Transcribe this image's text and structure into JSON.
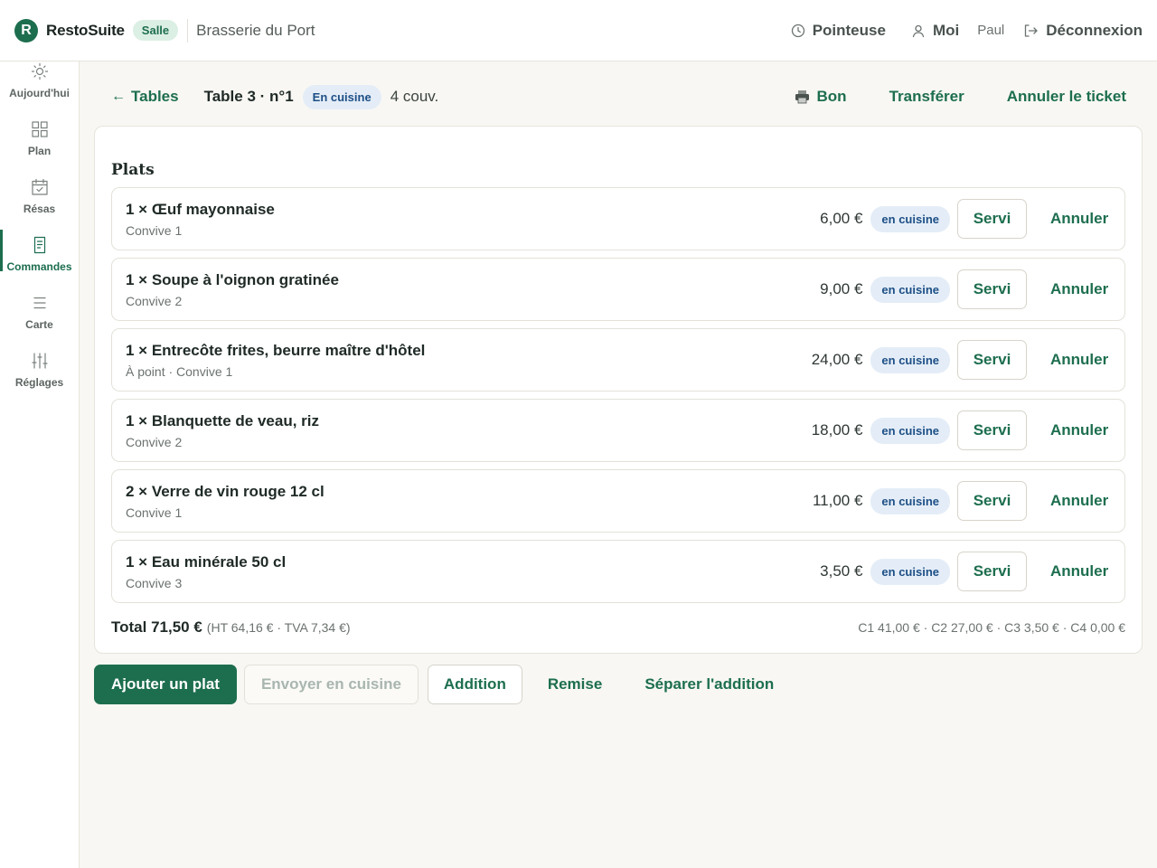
{
  "app": {
    "logo_letter": "R",
    "name": "RestoSuite",
    "role": "Salle",
    "restaurant": "Brasserie du Port"
  },
  "topbar": {
    "clock_label": "Pointeuse",
    "profile_label": "Moi",
    "user_name": "Paul",
    "logout_label": "Déconnexion"
  },
  "sidebar": {
    "items": [
      {
        "label": "Aujourd'hui",
        "icon": "sun-icon",
        "active": false
      },
      {
        "label": "Plan",
        "icon": "grid-icon",
        "active": false
      },
      {
        "label": "Résas",
        "icon": "calendar-icon",
        "active": false
      },
      {
        "label": "Commandes",
        "icon": "receipt-icon",
        "active": true
      },
      {
        "label": "Carte",
        "icon": "list-icon",
        "active": false
      },
      {
        "label": "Réglages",
        "icon": "sliders-icon",
        "active": false
      }
    ]
  },
  "header": {
    "back_arrow": "←",
    "back_label": "Tables",
    "table_title": "Table 3 · n°1",
    "status": "En cuisine",
    "covers": "4 couv.",
    "actions": {
      "print": "Bon",
      "transfer": "Transférer",
      "cancel": "Annuler le ticket"
    }
  },
  "order": {
    "section_title": "Plats",
    "items": [
      {
        "name": "1 × Œuf mayonnaise",
        "sub": "Convive 1",
        "price": "6,00 €",
        "status": "en cuisine",
        "served_label": "Servi",
        "cancel_label": "Annuler"
      },
      {
        "name": "1 × Soupe à l'oignon gratinée",
        "sub": "Convive 2",
        "price": "9,00 €",
        "status": "en cuisine",
        "served_label": "Servi",
        "cancel_label": "Annuler"
      },
      {
        "name": "1 × Entrecôte frites, beurre maître d'hôtel",
        "sub": "À point · Convive 1",
        "price": "24,00 €",
        "status": "en cuisine",
        "served_label": "Servi",
        "cancel_label": "Annuler"
      },
      {
        "name": "1 × Blanquette de veau, riz",
        "sub": "Convive 2",
        "price": "18,00 €",
        "status": "en cuisine",
        "served_label": "Servi",
        "cancel_label": "Annuler"
      },
      {
        "name": "2 × Verre de vin rouge 12 cl",
        "sub": "Convive 1",
        "price": "11,00 €",
        "status": "en cuisine",
        "served_label": "Servi",
        "cancel_label": "Annuler"
      },
      {
        "name": "1 × Eau minérale 50 cl",
        "sub": "Convive 3",
        "price": "3,50 €",
        "status": "en cuisine",
        "served_label": "Servi",
        "cancel_label": "Annuler"
      }
    ],
    "total": "Total 71,50 €",
    "total_detail": "(HT 64,16 € · TVA 7,34 €)",
    "per_guest": "C1 41,00 € · C2 27,00 € · C3 3,50 € · C4 0,00 €"
  },
  "actions": {
    "add": "Ajouter un plat",
    "send": "Envoyer en cuisine",
    "bill": "Addition",
    "discount": "Remise",
    "split": "Séparer l'addition"
  },
  "colors": {
    "accent": "#1d6e4f",
    "status_bg": "#e4edf7",
    "status_text": "#1d4f86",
    "background": "#f8f7f3"
  }
}
